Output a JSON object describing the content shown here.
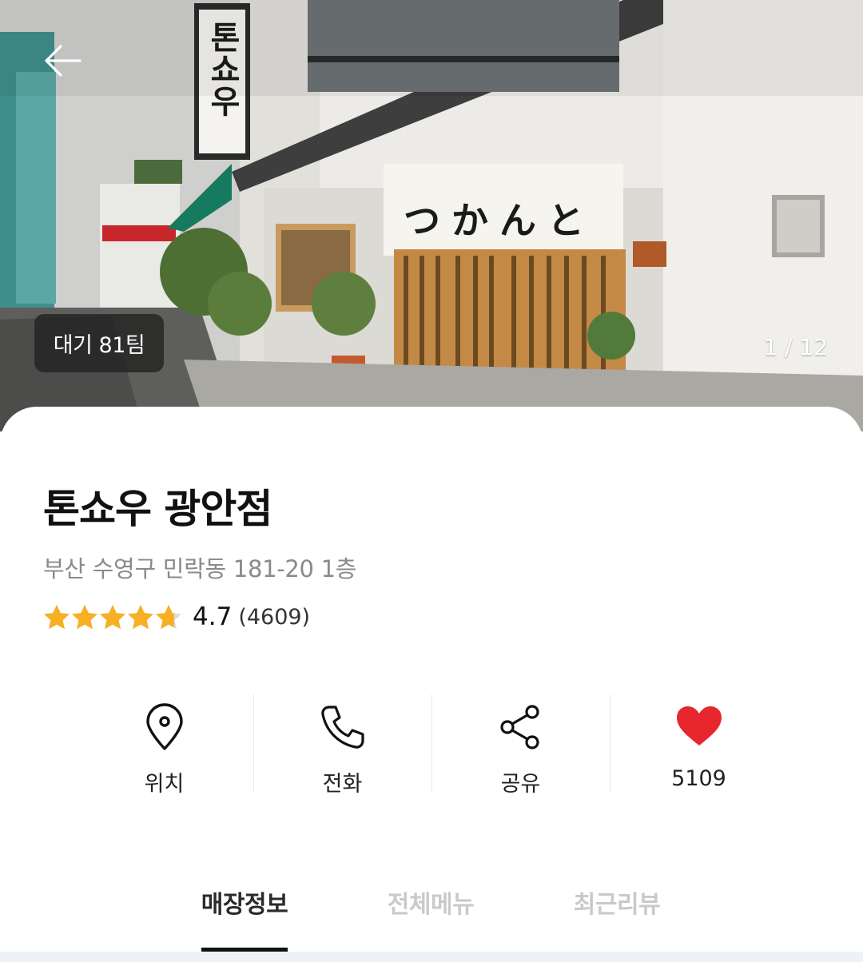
{
  "hero": {
    "wait_badge": "대기 81팀",
    "photo_counter": "1 / 12",
    "sign_text": "톤쇼우",
    "curtain_text": "つかんと"
  },
  "store": {
    "name": "톤쇼우 광안점",
    "address": "부산 수영구 민락동 181-20 1층",
    "rating": "4.7",
    "review_count": "(4609)",
    "rating_stars": 4.7
  },
  "actions": [
    {
      "label": "위치",
      "icon": "location-pin-icon"
    },
    {
      "label": "전화",
      "icon": "phone-icon"
    },
    {
      "label": "공유",
      "icon": "share-icon"
    },
    {
      "label": "5109",
      "icon": "heart-icon"
    }
  ],
  "tabs": [
    {
      "label": "매장정보",
      "active": true
    },
    {
      "label": "전체메뉴",
      "active": false
    },
    {
      "label": "최근리뷰",
      "active": false
    }
  ],
  "colors": {
    "star": "#f7b024",
    "heart": "#e8262d",
    "muted_text": "#8a8a8a",
    "inactive_tab": "#c9c9c9"
  }
}
